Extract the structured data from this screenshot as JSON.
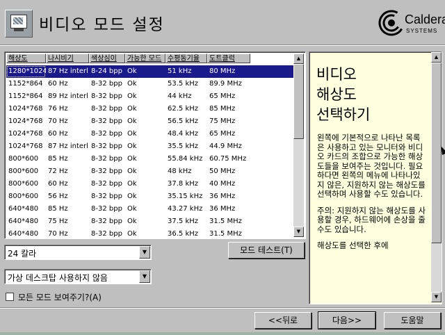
{
  "header": {
    "title": "비디오 모드 설정",
    "logo_name": "Caldera",
    "logo_sub": "SYSTEMS"
  },
  "table": {
    "columns": [
      "해상도",
      "나시비기",
      "색상심이",
      "가능한 모드",
      "수평동기율",
      "도트클럭"
    ],
    "rows": [
      [
        "1280*1024",
        "87 Hz interl.",
        "8-24 bpp",
        "Ok",
        "51 kHz",
        "80 MHz"
      ],
      [
        "1152*864",
        "60 Hz",
        "8-32 bpp",
        "Ok",
        "53.5 kHz",
        "89.9 MHz"
      ],
      [
        "1152*864",
        "89 Hz interl.",
        "8-32 bpp",
        "Ok",
        "44 kHz",
        "65 MHz"
      ],
      [
        "1024*768",
        "76 Hz",
        "8-32 bpp",
        "Ok",
        "62.5 kHz",
        "85 MHz"
      ],
      [
        "1024*768",
        "70 Hz",
        "8-32 bpp",
        "Ok",
        "56.5 kHz",
        "75 MHz"
      ],
      [
        "1024*768",
        "60 Hz",
        "8-32 bpp",
        "Ok",
        "48.4 kHz",
        "65 MHz"
      ],
      [
        "1024*768",
        "87 Hz interl.",
        "8-32 bpp",
        "Ok",
        "35.5 kHz",
        "44.9 MHz"
      ],
      [
        "800*600",
        "85 Hz",
        "8-32 bpp",
        "Ok",
        "55.84 kHz",
        "60.75 MHz"
      ],
      [
        "800*600",
        "72 Hz",
        "8-32 bpp",
        "Ok",
        "48 kHz",
        "50 MHz"
      ],
      [
        "800*600",
        "60 Hz",
        "8-32 bpp",
        "Ok",
        "37.8 kHz",
        "40 MHz"
      ],
      [
        "800*600",
        "56 Hz",
        "8-32 bpp",
        "Ok",
        "35.15 kHz",
        "36 MHz"
      ],
      [
        "640*480",
        "85 Hz",
        "8-32 bpp",
        "Ok",
        "43.27 kHz",
        "36 MHz"
      ],
      [
        "640*480",
        "75 Hz",
        "8-32 bpp",
        "Ok",
        "37.5 kHz",
        "31.5 MHz"
      ],
      [
        "640*480",
        "70 Hz",
        "8-32 bpp",
        "Ok",
        "36.5 kHz",
        "31.5 MHz"
      ]
    ],
    "selected_index": 0,
    "scroll_arrow_up": "▲",
    "scroll_arrow_down": "▼"
  },
  "color_depth": {
    "value": "24 칼라",
    "arrow": "▼"
  },
  "virtual_desktop": {
    "value": "가상 데스크탑 사용하지 않음",
    "arrow": "▼"
  },
  "show_all_modes": {
    "label": "모든 모드 보여주기?(A)",
    "checked": false
  },
  "buttons": {
    "mode_test": "모드 테스트(T)",
    "back": "<<뒤로",
    "next": "다음>>",
    "help": "도움말"
  },
  "help_panel": {
    "heading": "비디오\n해상도\n선택하기",
    "paragraph1": "왼쪽에 기본적으로 나타난 목록은 사용하고 있는 모니터와 비디오 카드의 조합으로 가능한 해상도들을 보여주는 것입니다. 필요하다면 왼쪽의 메뉴에 나타나있지 않은, 지원하지 않는 해상도를 선택하며 사용할 수도 있습니다.",
    "paragraph2": "주의: 지원하지 않는 해상도를 사용할 경우, 하드웨어에 손상을 줄 수도 있습니다.",
    "paragraph3": "해상도를 선택한 후에"
  }
}
